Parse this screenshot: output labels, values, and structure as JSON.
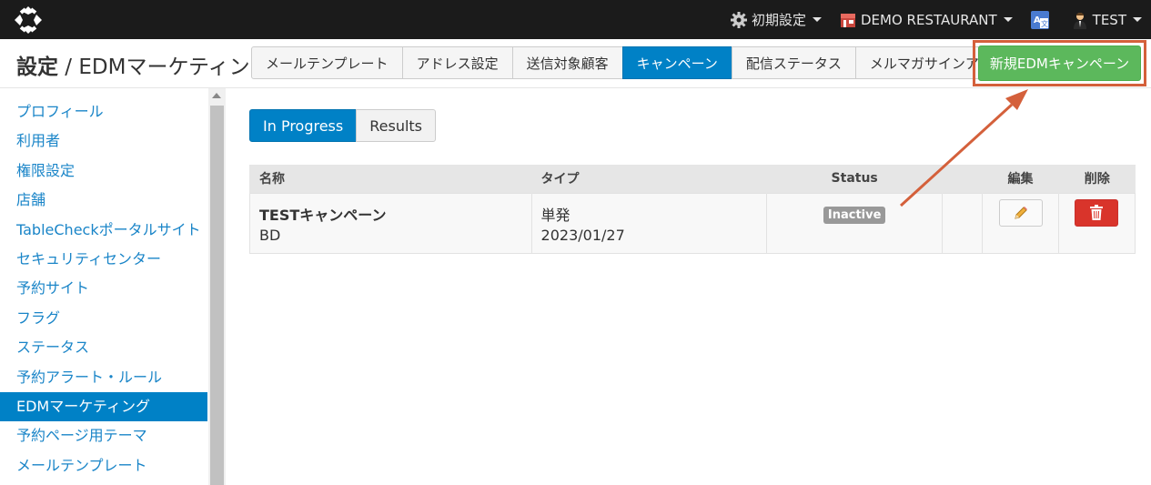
{
  "topbar": {
    "settings_label": "初期設定",
    "restaurant_label": "DEMO RESTAURANT",
    "user_label": "TEST"
  },
  "header": {
    "title_bold": "設定",
    "title_rest": " / EDMマーケティング"
  },
  "tabs": [
    {
      "label": "メールテンプレート"
    },
    {
      "label": "アドレス設定"
    },
    {
      "label": "送信対象顧客"
    },
    {
      "label": "キャンペーン"
    },
    {
      "label": "配信ステータス"
    },
    {
      "label": "メルマガサインアップ"
    }
  ],
  "new_button": "新規EDMキャンペーン",
  "sidebar": {
    "items": [
      {
        "label": "プロフィール"
      },
      {
        "label": "利用者"
      },
      {
        "label": "権限設定"
      },
      {
        "label": "店舗"
      },
      {
        "label": "TableCheckポータルサイト"
      },
      {
        "label": "セキュリティセンター"
      },
      {
        "label": "予約サイト"
      },
      {
        "label": "フラグ"
      },
      {
        "label": "ステータス"
      },
      {
        "label": "予約アラート・ルール"
      },
      {
        "label": "EDMマーケティング"
      },
      {
        "label": "予約ページ用テーマ"
      },
      {
        "label": "メールテンプレート"
      }
    ]
  },
  "segment": {
    "in_progress": "In Progress",
    "results": "Results"
  },
  "table": {
    "headers": {
      "name": "名称",
      "type": "タイプ",
      "status": "Status",
      "edit": "編集",
      "delete": "削除"
    },
    "rows": [
      {
        "name": "TESTキャンペーン",
        "sub": "BD",
        "type": "単発",
        "date": "2023/01/27",
        "status": "Inactive"
      }
    ]
  },
  "colors": {
    "primary": "#0081c6",
    "success": "#5cb85c",
    "danger": "#d9342b",
    "annotation": "#d4603b"
  }
}
